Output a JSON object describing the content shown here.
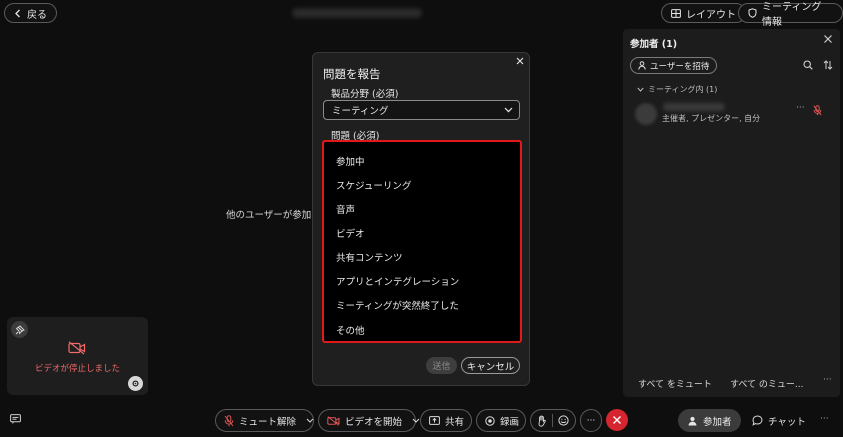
{
  "topbar": {
    "back_label": "戻る",
    "layout_label": "レイアウト",
    "info_label": "ミーティング 情報"
  },
  "stage": {
    "message": "他のユーザーが参加す"
  },
  "self_view": {
    "status": "ビデオが停止しました"
  },
  "participants_panel": {
    "title": "参加者 (1)",
    "invite_label": "ユーザーを招待",
    "group_label": "ミーティング内 (1)",
    "participant_role": "主催者, プレゼンター, 自分",
    "mute_all_label": "すべて をミュート",
    "mute_all_more_label": "すべて のミュー..."
  },
  "toolbar": {
    "mute_label": "ミュート解除",
    "video_label": "ビデオを開始",
    "share_label": "共有",
    "record_label": "録画",
    "participants_label": "参加者",
    "chat_label": "チャット"
  },
  "dialog": {
    "title": "問題を報告",
    "area_label": "製品分野 (必須)",
    "area_value": "ミーティング",
    "issue_label": "問題 (必須)",
    "issue_options": [
      "参加中",
      "スケジューリング",
      "音声",
      "ビデオ",
      "共有コンテンツ",
      "アプリとインテグレーション",
      "ミーティングが突然終了した",
      "その他"
    ],
    "send_label": "送信",
    "cancel_label": "キャンセル"
  },
  "colors": {
    "background": "#0e0e0e",
    "panel": "#1c1c1c",
    "dialog": "#1f1f1f",
    "highlight_border": "#e01a1a",
    "leave_red": "#d5262f",
    "muted_red": "#f06a6a"
  }
}
